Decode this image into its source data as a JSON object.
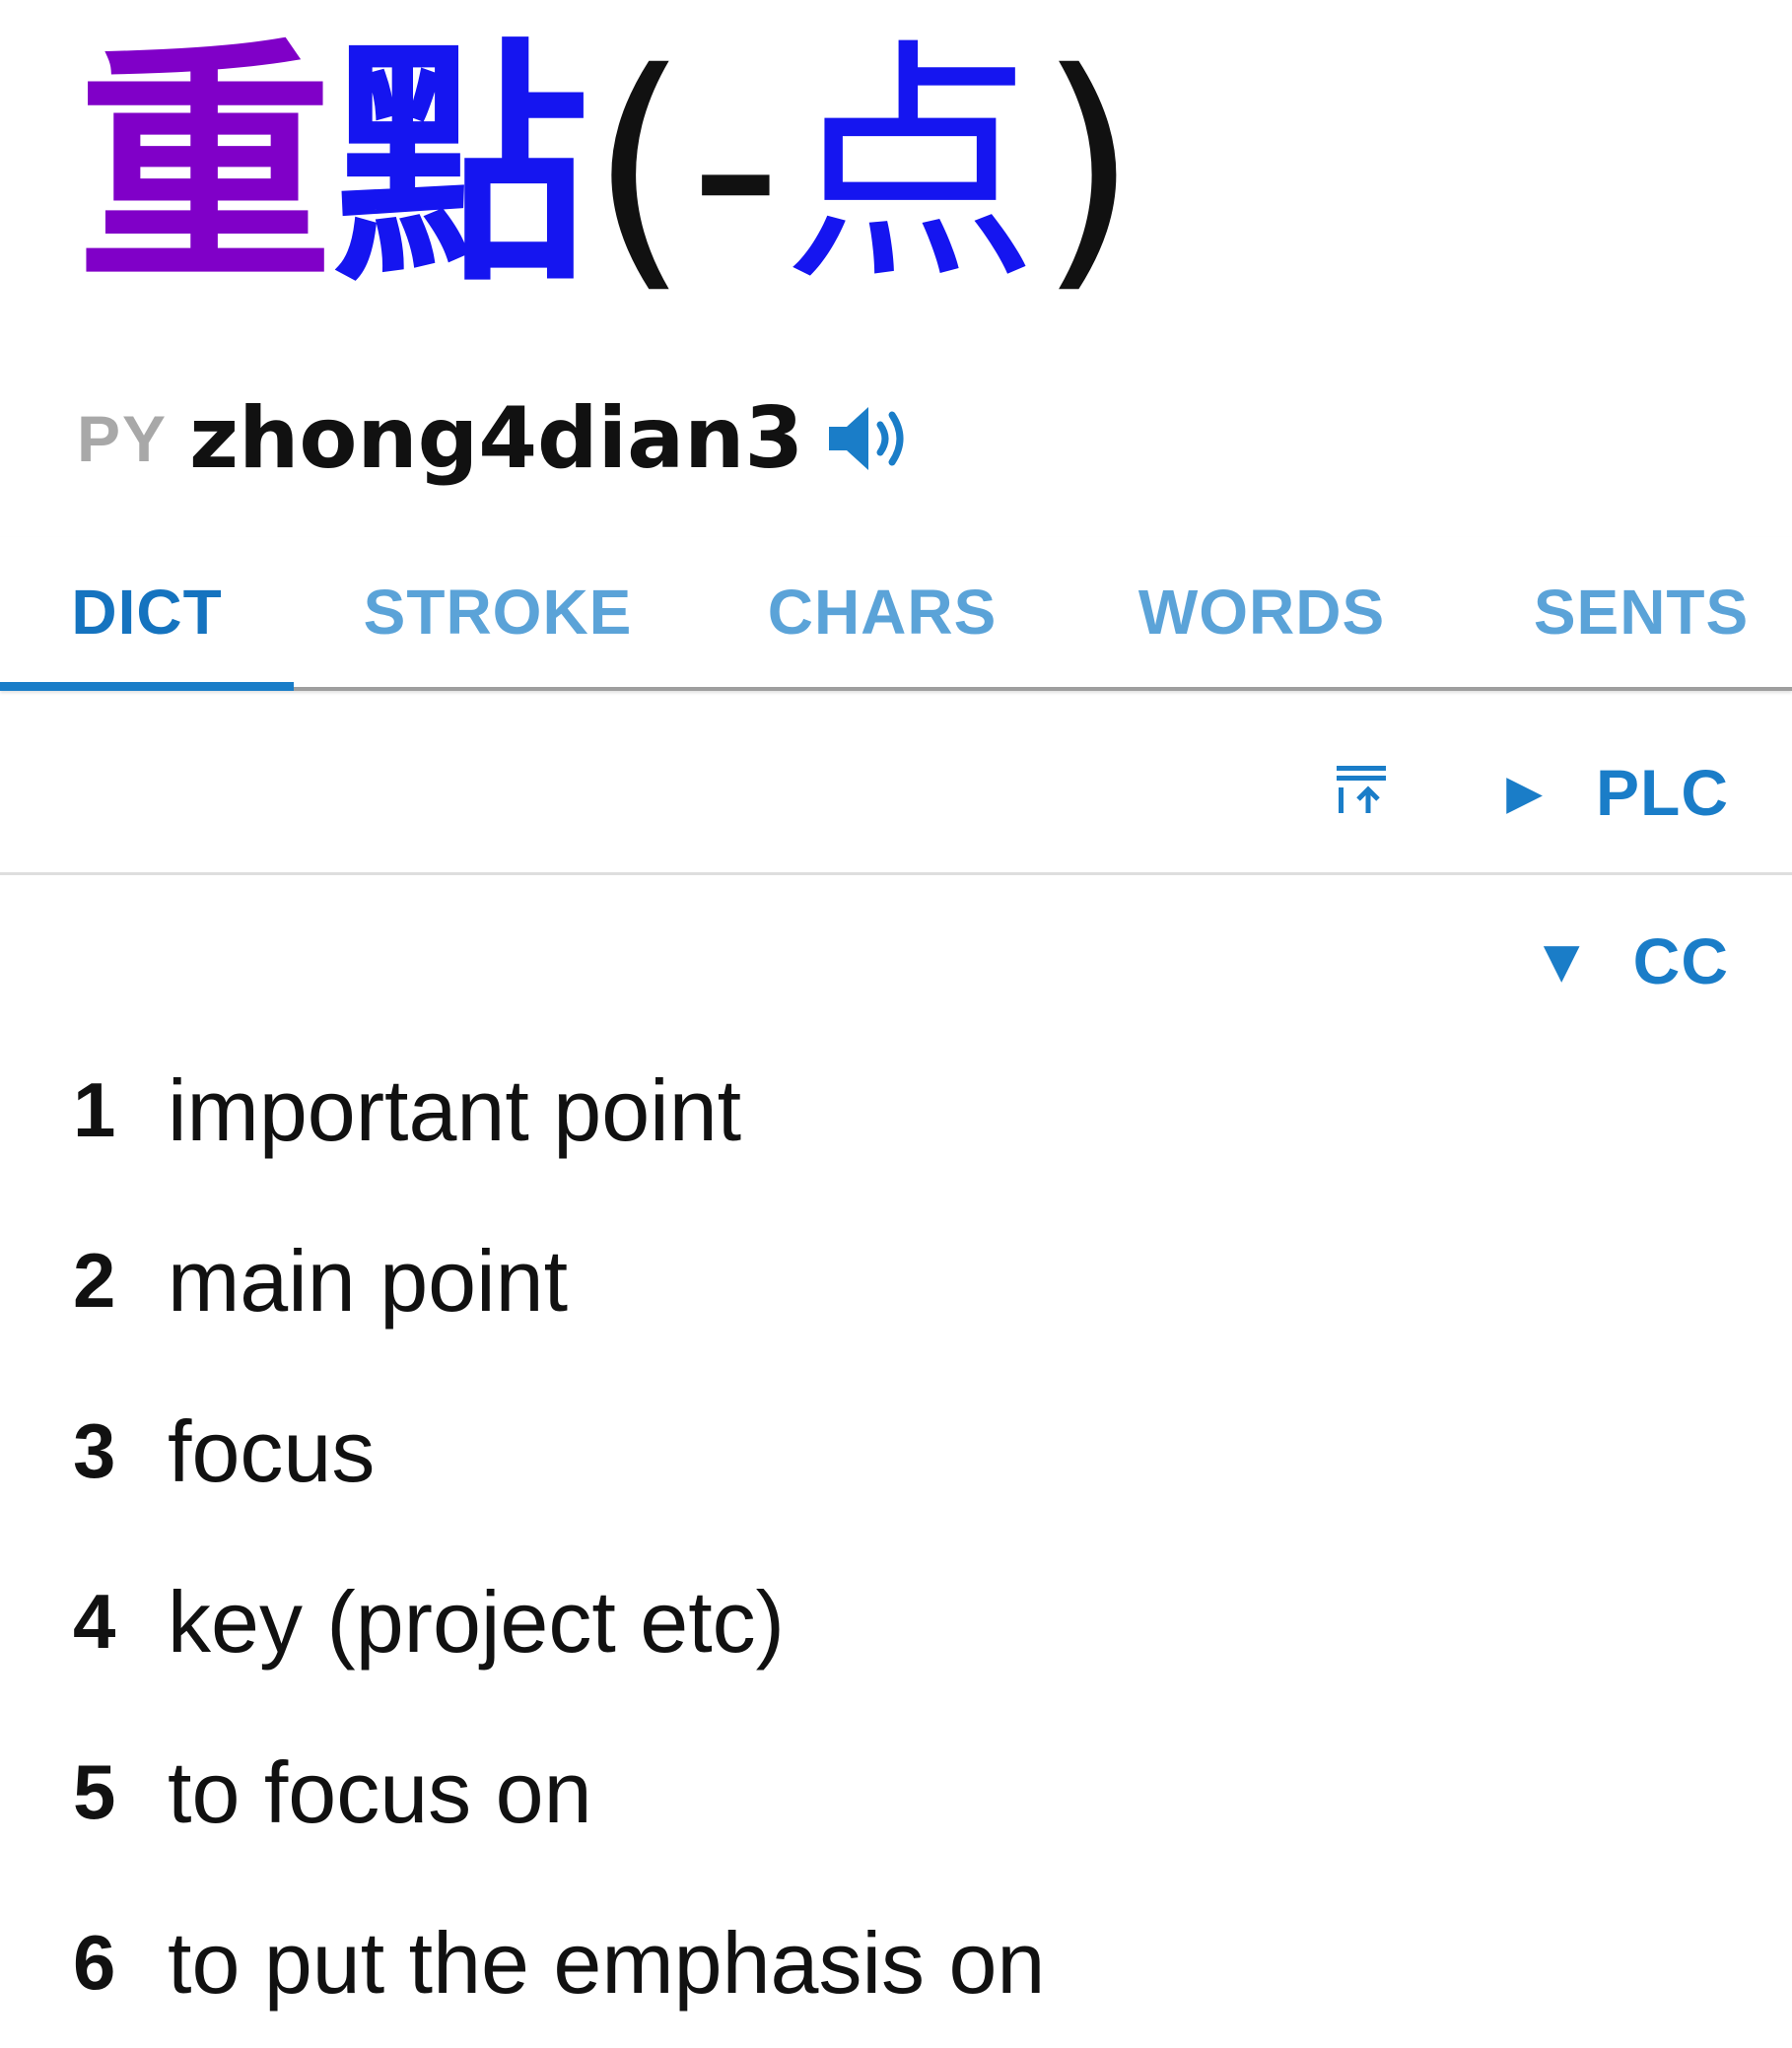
{
  "headword": {
    "char1": "重",
    "char2": "點",
    "bracket_open": "(",
    "dash": "-",
    "trad_char": "点",
    "bracket_close": ")",
    "colors": {
      "char1": "#8000c8",
      "char2": "#1515f0"
    }
  },
  "pinyin": {
    "tag": "PY",
    "text": "zhong4dian3",
    "audio_icon": "speaker-icon"
  },
  "tabs": [
    {
      "label": "DICT",
      "active": true
    },
    {
      "label": "STROKE",
      "active": false
    },
    {
      "label": "CHARS",
      "active": false
    },
    {
      "label": "WORDS",
      "active": false
    },
    {
      "label": "SENTS",
      "active": false
    }
  ],
  "toolbar": {
    "collapse_icon": "collapse-all-icon",
    "plc": {
      "arrow": "▶",
      "label": "PLC",
      "expanded": false
    },
    "cc": {
      "arrow": "▼",
      "label": "CC",
      "expanded": true
    }
  },
  "definitions": [
    {
      "num": "1",
      "text": "important point"
    },
    {
      "num": "2",
      "text": "main point"
    },
    {
      "num": "3",
      "text": "focus"
    },
    {
      "num": "4",
      "text": "key (project etc)"
    },
    {
      "num": "5",
      "text": "to focus on"
    },
    {
      "num": "6",
      "text": "to put the emphasis on"
    }
  ],
  "colors": {
    "accent": "#1a7dc8",
    "tab_inactive": "#5ba3d8",
    "text": "#111111",
    "muted": "#a8a8a8"
  }
}
